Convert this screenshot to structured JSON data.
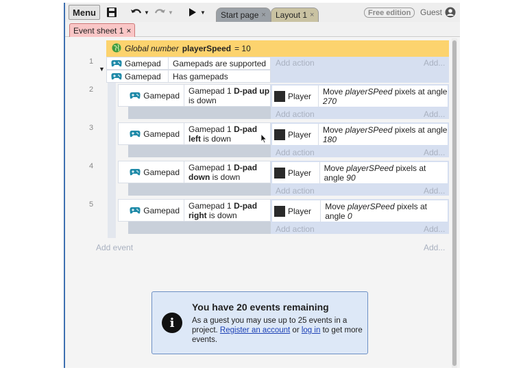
{
  "toolbar": {
    "menu_label": "Menu",
    "save_icon": "save-icon",
    "undo_icon": "undo-icon",
    "redo_icon": "redo-icon",
    "play_icon": "play-icon",
    "tabs": [
      {
        "label": "Start page",
        "close": "×"
      },
      {
        "label": "Layout 1",
        "close": "×"
      }
    ],
    "edition_badge": "Free edition",
    "user_label": "Guest"
  },
  "document_tab": {
    "label": "Event sheet 1",
    "close": "×"
  },
  "global_variable": {
    "prefix": "Global number",
    "name": "playerSpeed",
    "value": "= 10"
  },
  "events": [
    {
      "number": "1",
      "conditions": [
        {
          "object": "Gamepad",
          "text": "Gamepads are supported"
        },
        {
          "object": "Gamepad",
          "text": "Has gamepads"
        }
      ],
      "add_action": "Add action",
      "add_more": "Add..."
    },
    {
      "number": "2",
      "object": "Gamepad",
      "cond_pre": "Gamepad 1",
      "cond_bold1": "D-pad up",
      "cond_post": "is down",
      "action_object": "Player",
      "action_pre": "Move",
      "action_var": "playerSPeed",
      "action_mid": "pixels at angle",
      "action_angle": "270",
      "add_action": "Add action",
      "add_more": "Add..."
    },
    {
      "number": "3",
      "object": "Gamepad",
      "cond_pre": "Gamepad 1",
      "cond_bold1": "D-pad",
      "cond_bold2": "left",
      "cond_post": "is down",
      "action_object": "Player",
      "action_pre": "Move",
      "action_var": "playerSPeed",
      "action_mid": "pixels at angle",
      "action_angle": "180",
      "add_action": "Add action",
      "add_more": "Add..."
    },
    {
      "number": "4",
      "object": "Gamepad",
      "cond_pre": "Gamepad 1",
      "cond_bold1": "D-pad",
      "cond_bold2": "down",
      "cond_post": "is down",
      "action_object": "Player",
      "action_pre": "Move",
      "action_var": "playerSPeed",
      "action_mid": "pixels at angle",
      "action_angle": "90",
      "add_action": "Add action",
      "add_more": "Add..."
    },
    {
      "number": "5",
      "object": "Gamepad",
      "cond_pre": "Gamepad 1",
      "cond_bold1": "D-pad",
      "cond_bold2": "right",
      "cond_post": "is down",
      "action_object": "Player",
      "action_pre": "Move",
      "action_var": "playerSPeed",
      "action_mid": "pixels at angle",
      "action_angle": "0",
      "add_action": "Add action",
      "add_more": "Add..."
    }
  ],
  "footer": {
    "add_event": "Add event",
    "add_more": "Add..."
  },
  "notice": {
    "title": "You have 20 events remaining",
    "body_pre": "As a guest you may use up to 25 events in a project.",
    "register_link": "Register an account",
    "or_text": "or",
    "login_link": "log in",
    "body_post": "to get more events.",
    "icon": "info-icon"
  },
  "colors": {
    "global_var_bg": "#fcd36e",
    "document_tab_bg": "#f9c6c6",
    "action_bg": "#d6dff0",
    "notice_bg": "#dde8f7",
    "gamepad_icon": "#1f8aa8"
  }
}
